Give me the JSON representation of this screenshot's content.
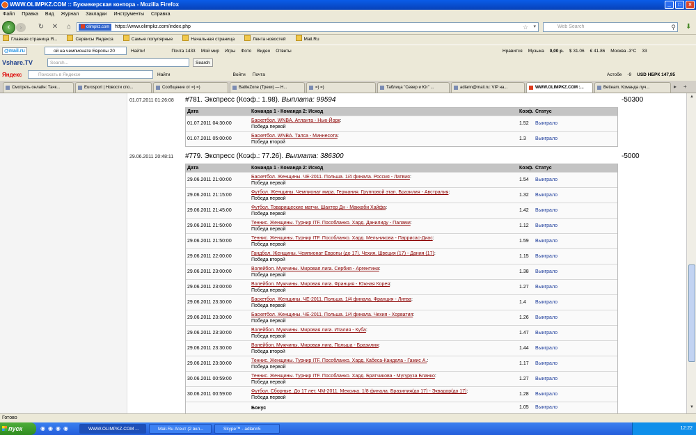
{
  "window": {
    "title": "WWW.OLIMPKZ.COM :: Букмекерская контора - Mozilla Firefox"
  },
  "menu": [
    "Файл",
    "Правка",
    "Вид",
    "Журнал",
    "Закладки",
    "Инструменты",
    "Справка"
  ],
  "nav": {
    "site_badge": "olimpkz.com",
    "url": "https://www.olimpkz.com/index.php",
    "search_placeholder": "Web Search"
  },
  "bookmarks": [
    "Главная страница Я...",
    "Сервисы Яндекса",
    "Самые популярные",
    "Начальная страница",
    "Лента новостей",
    "Mail.Ru"
  ],
  "mailru": {
    "logo": "@mail.ru",
    "query": "ой на чемпионате Европы 20",
    "find": "Найти!",
    "items": [
      "Почта 1433",
      "Мой мир",
      "Игры",
      "Фото",
      "Видео",
      "Ответы"
    ],
    "right": [
      "Нравится",
      "Музыка",
      "0,00 р.",
      "$ 31.06",
      "€ 41.86",
      "Москва -3°C",
      "33"
    ]
  },
  "vshare": {
    "logo": "Vshare.TV",
    "placeholder": "Search...",
    "button": "Search"
  },
  "yandex": {
    "logo": "Яндекс",
    "placeholder": "Поискать в Яндексе",
    "find": "Найти",
    "items": [
      "Войти",
      "Почта"
    ],
    "right": [
      "Астобе",
      "-9",
      "USD НБРК 147,95"
    ]
  },
  "tabs": [
    "Смотреть онлайн: Тачк...",
    "Eurosport | Новости спо...",
    "Сообщение от =) =)",
    "BattleZone (Треки) — Н...",
    "=) =)",
    "Таблица \"Север и Юг\" ...",
    "adlann@mail.ru: VIP на...",
    "WWW.OLIMPKZ.COM :...",
    "Betteam. Команда луч..."
  ],
  "headers": {
    "date": "Дата",
    "teams": "Команда 1 - Команда 2: Исход",
    "coef": "Коэф.",
    "status": "Статус"
  },
  "bets": [
    {
      "date": "01.07.2011 01:26:08",
      "title": "#781. Экспресс (Коэф.: 1.98).",
      "payout": "Выплата: 99594",
      "amount": "-50300",
      "rows": [
        {
          "date": "01.07.2011 04:30:00",
          "event": "Баскетбол. WNBA. Атланта - Нью-Йорк",
          "result": "Победа первой",
          "coef": "1.52",
          "status": "Выиграло"
        },
        {
          "date": "01.07.2011 05:00:00",
          "event": "Баскетбол. WNBA. Талса - Миннесота",
          "result": "Победа второй",
          "coef": "1.3",
          "status": "Выиграло"
        }
      ]
    },
    {
      "date": "29.06.2011 20:48:11",
      "title": "#779. Экспресс (Коэф.: 77.26).",
      "payout": "Выплата: 386300",
      "amount": "-5000",
      "rows": [
        {
          "date": "29.06.2011 21:00:00",
          "event": "Баскетбол. Женщины. ЧЕ-2011. Польша. 1/4 финала. Россия - Латвия",
          "result": "Победа первой",
          "coef": "1.54",
          "status": "Выиграло"
        },
        {
          "date": "29.06.2011 21:15:00",
          "event": "Футбол. Женщины. Чемпионат мира. Германия. Групповой этап. Бразилия - Австралия",
          "result": "Победа первой",
          "coef": "1.32",
          "status": "Выиграло"
        },
        {
          "date": "29.06.2011 21:45:00",
          "event": "Футбол. Товарищеские матчи. Шахтер Дн - Маккаби Хайфа",
          "result": "Победа первой",
          "coef": "1.42",
          "status": "Выиграло"
        },
        {
          "date": "29.06.2011 21:50:00",
          "event": "Теннис. Женщины. Турнир ITF. Пособланко. Хард. Данилиду - Палами",
          "result": "Победа первой",
          "coef": "1.12",
          "status": "Выиграло"
        },
        {
          "date": "29.06.2011 21:50:00",
          "event": "Теннис. Женщины. Турнир ITF. Пособланко. Хард. Мельникова - Паррисас-Диас",
          "result": "Победа первой",
          "coef": "1.59",
          "status": "Выиграло"
        },
        {
          "date": "29.06.2011 22:00:00",
          "event": "Гандбол. Женщины. Чемпионат Европы (до 17). Чехия. Швеция (17) - Дания (17)",
          "result": "Победа второй",
          "coef": "1.15",
          "status": "Выиграло"
        },
        {
          "date": "29.06.2011 23:00:00",
          "event": "Волейбол. Мужчины. Мировая лига. Сербия - Аргентина",
          "result": "Победа первой",
          "coef": "1.38",
          "status": "Выиграло"
        },
        {
          "date": "29.06.2011 23:00:00",
          "event": "Волейбол. Мужчины. Мировая лига. Франция - Южная Корея",
          "result": "Победа первой",
          "coef": "1.27",
          "status": "Выиграло"
        },
        {
          "date": "29.06.2011 23:30:00",
          "event": "Баскетбол. Женщины. ЧЕ-2011. Польша. 1/4 финала. Франция - Литва",
          "result": "Победа первой",
          "coef": "1.4",
          "status": "Выиграло"
        },
        {
          "date": "29.06.2011 23:30:00",
          "event": "Баскетбол. Женщины. ЧЕ-2011. Польша. 1/4 финала. Чехия - Хорватия",
          "result": "Победа первой",
          "coef": "1.26",
          "status": "Выиграло"
        },
        {
          "date": "29.06.2011 23:30:00",
          "event": "Волейбол. Мужчины. Мировая лига. Италия - Куба",
          "result": "Победа первой",
          "coef": "1.47",
          "status": "Выиграло"
        },
        {
          "date": "29.06.2011 23:30:00",
          "event": "Волейбол. Мужчины. Мировая лига. Польша - Бразилия",
          "result": "Победа второй",
          "coef": "1.44",
          "status": "Выиграло"
        },
        {
          "date": "29.06.2011 23:30:00",
          "event": "Теннис. Женщины. Турнир ITF. Пособланко. Хард. Кабеса-Кандела - Гамис А.",
          "result": "Победа первой",
          "coef": "1.17",
          "status": "Выиграло"
        },
        {
          "date": "30.06.2011 00:59:00",
          "event": "Теннис. Женщины. Турнир ITF. Пособланко. Хард. Братчикова - Мугуруза Бланко",
          "result": "Победа первой",
          "coef": "1.27",
          "status": "Выиграло"
        },
        {
          "date": "30.06.2011 00:59:00",
          "event": "Футбол. Сборные. До 17 лет. ЧМ-2011. Мексика. 1/8 финала. Бразилия(до 17) - Эквадор(до 17)",
          "result": "Победа первой",
          "coef": "1.28",
          "status": "Выиграло"
        }
      ],
      "bonus": {
        "label": "Бонус",
        "coef": "1.05",
        "status": "Выиграло"
      }
    }
  ],
  "statusbar": "Готово",
  "taskbar": {
    "start": "пуск",
    "buttons": [
      "WWW.OLIMPKZ.COM ...",
      "Mail.Ru Агент (2 вкл...",
      "Skype™ - adlann5"
    ],
    "clock": "12:22"
  }
}
